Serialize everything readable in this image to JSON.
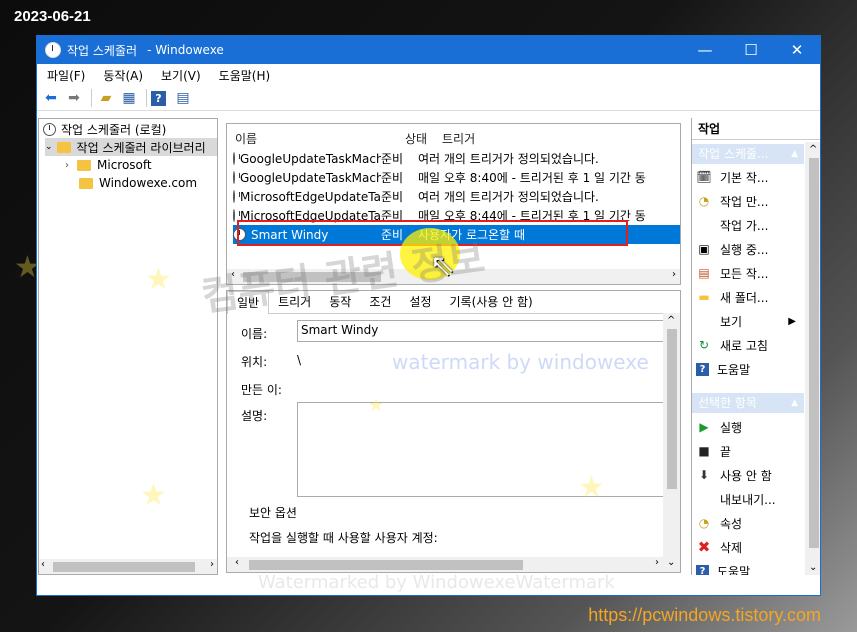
{
  "overlay": {
    "date": "2023-06-21",
    "url": "https://pcwindows.tistory.com",
    "watermark_korean": "컴퓨터 관련 정보",
    "watermark_by": "watermark by windowexe",
    "watermark_bottom": "Watermarked by WindowexeWatermark"
  },
  "window": {
    "title": "작업 스케줄러",
    "title_suffix": "- Windowexe",
    "minimize": "—",
    "maximize": "☐",
    "close": "✕"
  },
  "menu": [
    "파일(F)",
    "동작(A)",
    "보기(V)",
    "도움말(H)"
  ],
  "tree": {
    "root": "작업 스케줄러 (로컬)",
    "library": "작업 스케줄러 라이브러리",
    "children": [
      "Microsoft",
      "Windowexe.com"
    ]
  },
  "task_list": {
    "headers": [
      "이름",
      "상태",
      "트리거"
    ],
    "rows": [
      {
        "name": "GoogleUpdateTaskMachi...",
        "status": "준비",
        "trigger": "여러 개의 트리거가 정의되었습니다."
      },
      {
        "name": "GoogleUpdateTaskMachi...",
        "status": "준비",
        "trigger": "매일 오후 8:40에 - 트리거된 후 1 일 기간 동"
      },
      {
        "name": "MicrosoftEdgeUpdateTas...",
        "status": "준비",
        "trigger": "여러 개의 트리거가 정의되었습니다."
      },
      {
        "name": "MicrosoftEdgeUpdateTas...",
        "status": "준비",
        "trigger": "매일 오후 8:44에 - 트리거된 후 1 일 기간 동"
      },
      {
        "name": "Smart Windy",
        "status": "준비",
        "trigger": "사용자가 로그온할 때"
      }
    ]
  },
  "detail": {
    "tabs": [
      "일반",
      "트리거",
      "동작",
      "조건",
      "설정",
      "기록(사용 안 함)"
    ],
    "name_label": "이름:",
    "name_value": "Smart Windy",
    "location_label": "위치:",
    "location_value": "\\",
    "author_label": "만든 이:",
    "desc_label": "설명:",
    "security_label": "보안 옵션",
    "account_label": "작업을 실행할 때 사용할 사용자 계정:"
  },
  "actions": {
    "header": "작업",
    "section1": "작업 스케줄...",
    "items1": [
      {
        "label": "기본 작...",
        "icon": "basic-task-icon"
      },
      {
        "label": "작업 만...",
        "icon": "create-task-icon"
      },
      {
        "label": "작업 가...",
        "icon": "import-icon"
      },
      {
        "label": "실행 중...",
        "icon": "running-icon"
      },
      {
        "label": "모든 작...",
        "icon": "all-tasks-icon"
      },
      {
        "label": "새 폴더...",
        "icon": "new-folder-icon"
      },
      {
        "label": "보기",
        "icon": "view-icon"
      },
      {
        "label": "새로 고침",
        "icon": "refresh-icon"
      },
      {
        "label": "도움말",
        "icon": "help-icon"
      }
    ],
    "section2": "선택한 항목",
    "items2": [
      {
        "label": "실행",
        "icon": "run-icon"
      },
      {
        "label": "끝",
        "icon": "end-icon"
      },
      {
        "label": "사용 안 함",
        "icon": "disable-icon"
      },
      {
        "label": "내보내기...",
        "icon": "export-icon"
      },
      {
        "label": "속성",
        "icon": "properties-icon"
      },
      {
        "label": "삭제",
        "icon": "delete-icon"
      },
      {
        "label": "도움말",
        "icon": "help-icon"
      }
    ]
  },
  "colors": {
    "titlebar": "#1a6fd6",
    "selection": "#0078d7",
    "highlight_box": "#e02020"
  }
}
